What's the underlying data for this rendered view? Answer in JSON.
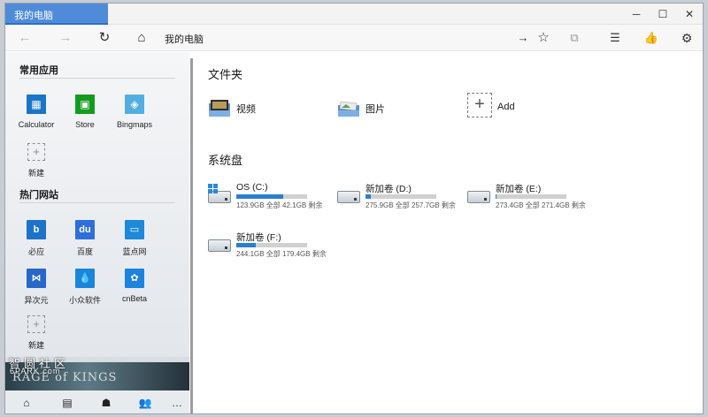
{
  "window": {
    "tab_title": "我的电脑",
    "minimize": "─",
    "maximize": "☐",
    "close": "✕"
  },
  "addressbar": {
    "back": "←",
    "forward": "→",
    "refresh": "↻",
    "home": "⌂",
    "address": "我的电脑",
    "go": "→",
    "favorite": "☆",
    "share": "⧉",
    "list": "☰",
    "reading": "👍",
    "settings": "⚙"
  },
  "sidebar": {
    "common_apps_title": "常用应用",
    "common_apps": [
      {
        "label": "Calculator",
        "icon": "calculator-icon",
        "color": "#1a75c9",
        "glyph": "▦"
      },
      {
        "label": "Store",
        "icon": "store-icon",
        "color": "#139b1f",
        "glyph": "▣"
      },
      {
        "label": "Bingmaps",
        "icon": "maps-icon",
        "color": "#53aee0",
        "glyph": "◈"
      }
    ],
    "new_label": "新建",
    "new_glyph": "+",
    "hot_sites_title": "热门网站",
    "hot_sites": [
      {
        "label": "必应",
        "icon": "bing-icon",
        "color": "#1c73c8",
        "glyph": "b"
      },
      {
        "label": "百度",
        "icon": "baidu-icon",
        "color": "#2d6fdc",
        "glyph": "du"
      },
      {
        "label": "蓝点网",
        "icon": "landian-icon",
        "color": "#1c8ad8",
        "glyph": "▭"
      },
      {
        "label": "异次元",
        "icon": "iplaysoft-icon",
        "color": "#2767c9",
        "glyph": "⋈"
      },
      {
        "label": "小众软件",
        "icon": "appinn-icon",
        "color": "#1a85dc",
        "glyph": "💧"
      },
      {
        "label": "cnBeta",
        "icon": "cnbeta-icon",
        "color": "#1d83dc",
        "glyph": "✿"
      }
    ],
    "new_site_label": "新建",
    "watermark_cn": "智圆社区",
    "watermark_en": "6PARK.com",
    "banner_text": "RAGE of KINGS",
    "bottom_icons": [
      "⌂",
      "▤",
      "☗",
      "👥",
      "…"
    ]
  },
  "main": {
    "folders_title": "文件夹",
    "folders": [
      {
        "label": "视频",
        "icon": "video-folder-icon"
      },
      {
        "label": "图片",
        "icon": "pictures-folder-icon"
      },
      {
        "label": "Add",
        "icon": "add-icon",
        "glyph": "+"
      }
    ],
    "drives_title": "系统盘",
    "drives": [
      {
        "name": "OS (C:)",
        "detail": "123.9GB 全部  42.1GB 剩余",
        "used_fraction": 0.66,
        "system": true
      },
      {
        "name": "新加卷 (D:)",
        "detail": "275.9GB 全部  257.7GB 剩余",
        "used_fraction": 0.07,
        "system": false
      },
      {
        "name": "新加卷 (E:)",
        "detail": "273.4GB 全部  271.4GB 剩余",
        "used_fraction": 0.01,
        "system": false
      },
      {
        "name": "新加卷 (F:)",
        "detail": "244.1GB 全部  179.4GB 剩余",
        "used_fraction": 0.27,
        "system": false
      }
    ]
  },
  "colors": {
    "accent": "#2a7fd1",
    "tab": "#4f8bd9"
  }
}
